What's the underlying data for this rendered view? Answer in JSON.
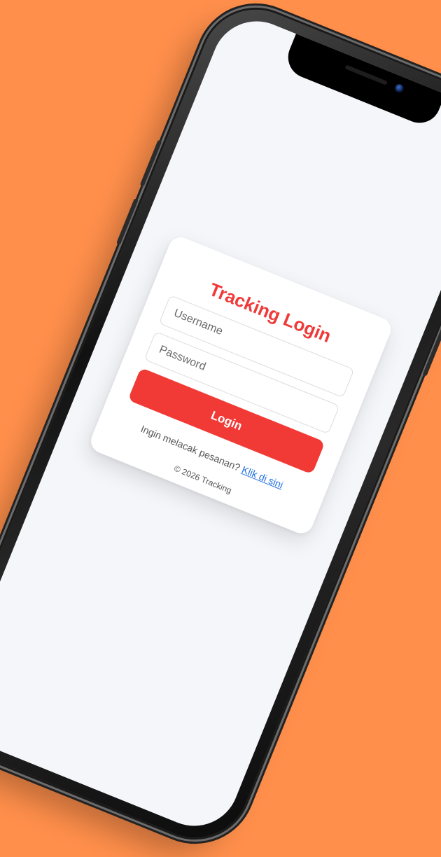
{
  "colors": {
    "background": "#ff8f4b",
    "screen": "#f5f6fa",
    "card": "#ffffff",
    "accent": "#f13a35",
    "link": "#1f6fe0"
  },
  "login": {
    "title": "Tracking Login",
    "username_placeholder": "Username",
    "password_placeholder": "Password",
    "button_label": "Login",
    "track_prompt": "Ingin melacak pesanan?",
    "track_link": "Klik di sini",
    "footer": "© 2026 Tracking"
  },
  "device": {
    "icons": [
      "front-camera-icon"
    ]
  }
}
